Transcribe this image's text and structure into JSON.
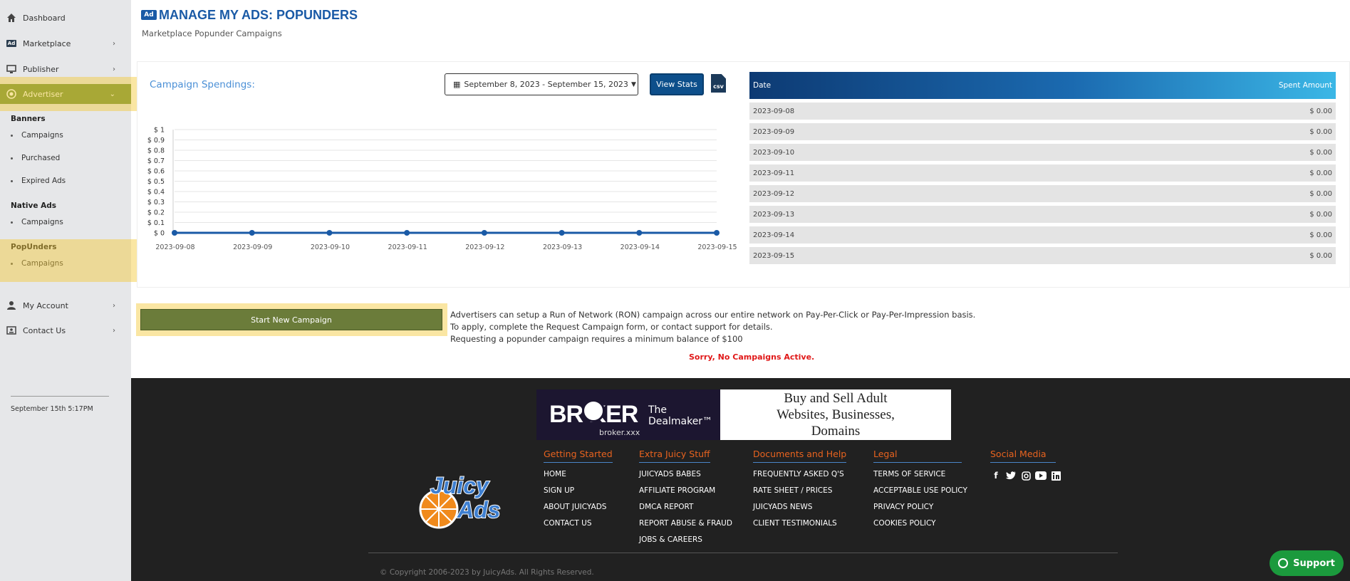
{
  "sidebar": {
    "items": [
      {
        "label": "Dashboard",
        "icon": "home-icon"
      },
      {
        "label": "Marketplace",
        "icon": "ad-icon"
      },
      {
        "label": "Publisher",
        "icon": "monitor-icon"
      },
      {
        "label": "Advertiser",
        "icon": "target-icon"
      }
    ],
    "sections": {
      "banners": {
        "title": "Banners",
        "items": [
          "Campaigns",
          "Purchased",
          "Expired Ads"
        ]
      },
      "native": {
        "title": "Native Ads",
        "items": [
          "Campaigns"
        ]
      },
      "popunders": {
        "title": "PopUnders",
        "items": [
          "Campaigns"
        ]
      }
    },
    "bottom": [
      {
        "label": "My Account",
        "icon": "user-icon"
      },
      {
        "label": "Contact Us",
        "icon": "contact-icon"
      }
    ],
    "datetime": "September 15th 5:17PM"
  },
  "header": {
    "badge": "Ad",
    "title": "MANAGE MY ADS: POPUNDERS",
    "subtitle": "Marketplace Popunder Campaigns"
  },
  "controls": {
    "chart_title": "Campaign Spendings:",
    "date_range": "September 8, 2023 - September 15, 2023",
    "view_stats": "View Stats",
    "csv": "csv"
  },
  "table": {
    "headers": [
      "Date",
      "Spent Amount"
    ],
    "rows": [
      {
        "date": "2023-09-08",
        "amount": "$ 0.00"
      },
      {
        "date": "2023-09-09",
        "amount": "$ 0.00"
      },
      {
        "date": "2023-09-10",
        "amount": "$ 0.00"
      },
      {
        "date": "2023-09-11",
        "amount": "$ 0.00"
      },
      {
        "date": "2023-09-12",
        "amount": "$ 0.00"
      },
      {
        "date": "2023-09-13",
        "amount": "$ 0.00"
      },
      {
        "date": "2023-09-14",
        "amount": "$ 0.00"
      },
      {
        "date": "2023-09-15",
        "amount": "$ 0.00"
      }
    ]
  },
  "chart_data": {
    "type": "line",
    "title": "",
    "xlabel": "",
    "ylabel": "",
    "x": [
      "2023-09-08",
      "2023-09-09",
      "2023-09-10",
      "2023-09-11",
      "2023-09-12",
      "2023-09-13",
      "2023-09-14",
      "2023-09-15"
    ],
    "series": [
      {
        "values": [
          0,
          0,
          0,
          0,
          0,
          0,
          0,
          0
        ],
        "color": "#1a5aa6"
      }
    ],
    "ylim": [
      0,
      1
    ],
    "yticks": [
      "$ 0",
      "$ 0.1",
      "$ 0.2",
      "$ 0.3",
      "$ 0.4",
      "$ 0.5",
      "$ 0.6",
      "$ 0.7",
      "$ 0.8",
      "$ 0.9",
      "$ 1"
    ],
    "grid": true
  },
  "campaign": {
    "start_button": "Start New Campaign",
    "info": [
      "Advertisers can setup a Run of Network (RON) campaign across our entire network on Pay-Per-Click or Pay-Per-Impression basis.",
      "To apply, complete the Request Campaign form, or contact support for details.",
      "Requesting a popunder campaign requires a minimum balance of $100"
    ],
    "no_campaigns": "Sorry, No Campaigns Active."
  },
  "banner": {
    "brand": "BR   KER",
    "tagline": "The Dealmaker™",
    "url": "broker.xxx",
    "headline": "Buy and Sell Adult Websites, Businesses, Domains"
  },
  "footer": {
    "logo": "JuicyAds",
    "columns": [
      {
        "title": "Getting Started",
        "links": [
          "HOME",
          "SIGN UP",
          "ABOUT JUICYADS",
          "CONTACT US"
        ]
      },
      {
        "title": "Extra Juicy Stuff",
        "links": [
          "JUICYADS BABES",
          "AFFILIATE PROGRAM",
          "DMCA REPORT",
          "REPORT ABUSE & FRAUD",
          "JOBS & CAREERS"
        ]
      },
      {
        "title": "Documents and Help",
        "links": [
          "FREQUENTLY ASKED Q'S",
          "RATE SHEET / PRICES",
          "JUICYADS NEWS",
          "CLIENT TESTIMONIALS"
        ]
      },
      {
        "title": "Legal",
        "links": [
          "TERMS OF SERVICE",
          "ACCEPTABLE USE POLICY",
          "PRIVACY POLICY",
          "COOKIES POLICY"
        ]
      }
    ],
    "social_title": "Social Media",
    "social": [
      "facebook-icon",
      "twitter-icon",
      "instagram-icon",
      "youtube-icon",
      "linkedin-icon"
    ],
    "copyright": "© Copyright 2006-2023 by JuicyAds. All Rights Reserved."
  },
  "support": "Support",
  "colors": {
    "accent": "#1a5aa6",
    "advertiser_active": "#6b8f3a",
    "highlight": "#f5c832",
    "footer_bg": "#212121",
    "alert": "#e01818"
  }
}
